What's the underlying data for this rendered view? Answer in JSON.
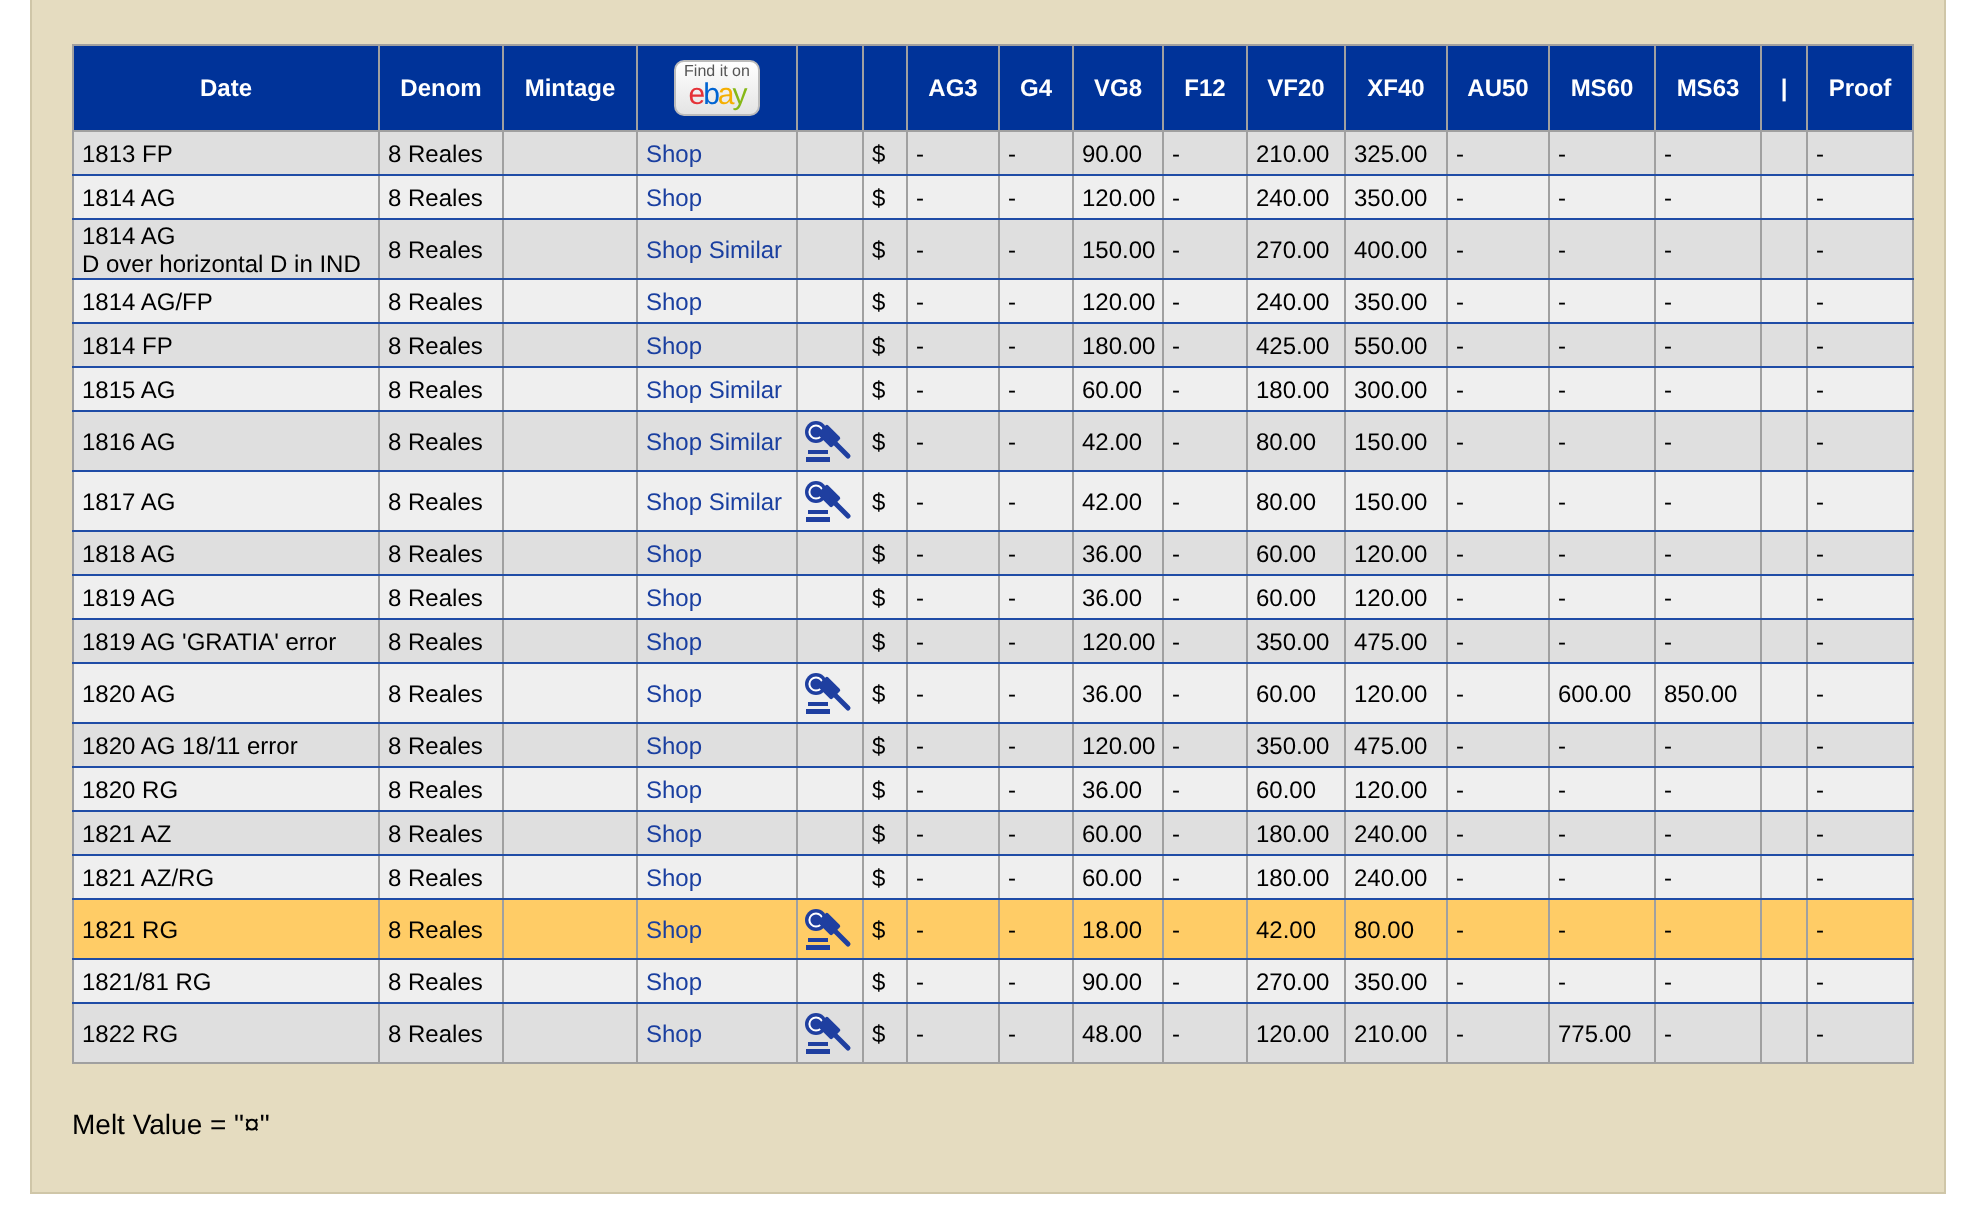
{
  "columns": [
    {
      "kind": "date",
      "label": "Date"
    },
    {
      "kind": "denom",
      "label": "Denom"
    },
    {
      "kind": "mintage",
      "label": "Mintage"
    },
    {
      "kind": "ebay",
      "find_text": "Find it on",
      "logo": "ebay"
    },
    {
      "kind": "auction"
    },
    {
      "kind": "currency"
    },
    {
      "kind": "grade",
      "label": "AG3"
    },
    {
      "kind": "grade",
      "label": "G4"
    },
    {
      "kind": "grade",
      "label": "VG8"
    },
    {
      "kind": "grade",
      "label": "F12"
    },
    {
      "kind": "grade",
      "label": "VF20"
    },
    {
      "kind": "grade",
      "label": "XF40"
    },
    {
      "kind": "grade",
      "label": "AU50"
    },
    {
      "kind": "grade",
      "label": "MS60"
    },
    {
      "kind": "grade",
      "label": "MS63"
    },
    {
      "kind": "separator",
      "label": "|"
    },
    {
      "kind": "grade",
      "label": "Proof"
    }
  ],
  "rows": [
    {
      "date": "1813 FP",
      "denom": "8 Reales",
      "shop": "Shop",
      "auction": false,
      "currency": "$",
      "grades": [
        "-",
        "-",
        "90.00",
        "-",
        "210.00",
        "325.00",
        "-",
        "-",
        "-",
        "-"
      ],
      "highlighted": false
    },
    {
      "date": "1814 AG",
      "denom": "8 Reales",
      "shop": "Shop",
      "auction": false,
      "currency": "$",
      "grades": [
        "-",
        "-",
        "120.00",
        "-",
        "240.00",
        "350.00",
        "-",
        "-",
        "-",
        "-"
      ],
      "highlighted": false
    },
    {
      "date": "1814 AG",
      "note": "D over horizontal D in IND",
      "denom": "8 Reales",
      "shop": "Shop Similar",
      "auction": false,
      "currency": "$",
      "grades": [
        "-",
        "-",
        "150.00",
        "-",
        "270.00",
        "400.00",
        "-",
        "-",
        "-",
        "-"
      ],
      "highlighted": false
    },
    {
      "date": "1814 AG/FP",
      "denom": "8 Reales",
      "shop": "Shop",
      "auction": false,
      "currency": "$",
      "grades": [
        "-",
        "-",
        "120.00",
        "-",
        "240.00",
        "350.00",
        "-",
        "-",
        "-",
        "-"
      ],
      "highlighted": false
    },
    {
      "date": "1814 FP",
      "denom": "8 Reales",
      "shop": "Shop",
      "auction": false,
      "currency": "$",
      "grades": [
        "-",
        "-",
        "180.00",
        "-",
        "425.00",
        "550.00",
        "-",
        "-",
        "-",
        "-"
      ],
      "highlighted": false
    },
    {
      "date": "1815 AG",
      "denom": "8 Reales",
      "shop": "Shop Similar",
      "auction": false,
      "currency": "$",
      "grades": [
        "-",
        "-",
        "60.00",
        "-",
        "180.00",
        "300.00",
        "-",
        "-",
        "-",
        "-"
      ],
      "highlighted": false
    },
    {
      "date": "1816 AG",
      "denom": "8 Reales",
      "shop": "Shop Similar",
      "auction": true,
      "currency": "$",
      "grades": [
        "-",
        "-",
        "42.00",
        "-",
        "80.00",
        "150.00",
        "-",
        "-",
        "-",
        "-"
      ],
      "highlighted": false
    },
    {
      "date": "1817 AG",
      "denom": "8 Reales",
      "shop": "Shop Similar",
      "auction": true,
      "currency": "$",
      "grades": [
        "-",
        "-",
        "42.00",
        "-",
        "80.00",
        "150.00",
        "-",
        "-",
        "-",
        "-"
      ],
      "highlighted": false
    },
    {
      "date": "1818 AG",
      "denom": "8 Reales",
      "shop": "Shop",
      "auction": false,
      "currency": "$",
      "grades": [
        "-",
        "-",
        "36.00",
        "-",
        "60.00",
        "120.00",
        "-",
        "-",
        "-",
        "-"
      ],
      "highlighted": false
    },
    {
      "date": "1819 AG",
      "denom": "8 Reales",
      "shop": "Shop",
      "auction": false,
      "currency": "$",
      "grades": [
        "-",
        "-",
        "36.00",
        "-",
        "60.00",
        "120.00",
        "-",
        "-",
        "-",
        "-"
      ],
      "highlighted": false
    },
    {
      "date": "1819 AG 'GRATIA' error",
      "denom": "8 Reales",
      "shop": "Shop",
      "auction": false,
      "currency": "$",
      "grades": [
        "-",
        "-",
        "120.00",
        "-",
        "350.00",
        "475.00",
        "-",
        "-",
        "-",
        "-"
      ],
      "highlighted": false
    },
    {
      "date": "1820 AG",
      "denom": "8 Reales",
      "shop": "Shop",
      "auction": true,
      "currency": "$",
      "grades": [
        "-",
        "-",
        "36.00",
        "-",
        "60.00",
        "120.00",
        "-",
        "600.00",
        "850.00",
        "-"
      ],
      "highlighted": false
    },
    {
      "date": "1820 AG 18/11 error",
      "denom": "8 Reales",
      "shop": "Shop",
      "auction": false,
      "currency": "$",
      "grades": [
        "-",
        "-",
        "120.00",
        "-",
        "350.00",
        "475.00",
        "-",
        "-",
        "-",
        "-"
      ],
      "highlighted": false
    },
    {
      "date": "1820 RG",
      "denom": "8 Reales",
      "shop": "Shop",
      "auction": false,
      "currency": "$",
      "grades": [
        "-",
        "-",
        "36.00",
        "-",
        "60.00",
        "120.00",
        "-",
        "-",
        "-",
        "-"
      ],
      "highlighted": false
    },
    {
      "date": "1821 AZ",
      "denom": "8 Reales",
      "shop": "Shop",
      "auction": false,
      "currency": "$",
      "grades": [
        "-",
        "-",
        "60.00",
        "-",
        "180.00",
        "240.00",
        "-",
        "-",
        "-",
        "-"
      ],
      "highlighted": false
    },
    {
      "date": "1821 AZ/RG",
      "denom": "8 Reales",
      "shop": "Shop",
      "auction": false,
      "currency": "$",
      "grades": [
        "-",
        "-",
        "60.00",
        "-",
        "180.00",
        "240.00",
        "-",
        "-",
        "-",
        "-"
      ],
      "highlighted": false
    },
    {
      "date": "1821 RG",
      "denom": "8 Reales",
      "shop": "Shop",
      "auction": true,
      "currency": "$",
      "grades": [
        "-",
        "-",
        "18.00",
        "-",
        "42.00",
        "80.00",
        "-",
        "-",
        "-",
        "-"
      ],
      "highlighted": true
    },
    {
      "date": "1821/81 RG",
      "denom": "8 Reales",
      "shop": "Shop",
      "auction": false,
      "currency": "$",
      "grades": [
        "-",
        "-",
        "90.00",
        "-",
        "270.00",
        "350.00",
        "-",
        "-",
        "-",
        "-"
      ],
      "highlighted": false
    },
    {
      "date": "1822 RG",
      "denom": "8 Reales",
      "shop": "Shop",
      "auction": true,
      "currency": "$",
      "grades": [
        "-",
        "-",
        "48.00",
        "-",
        "120.00",
        "210.00",
        "-",
        "775.00",
        "-",
        "-"
      ],
      "highlighted": false
    }
  ],
  "melt_value": "Melt Value = \"¤\""
}
